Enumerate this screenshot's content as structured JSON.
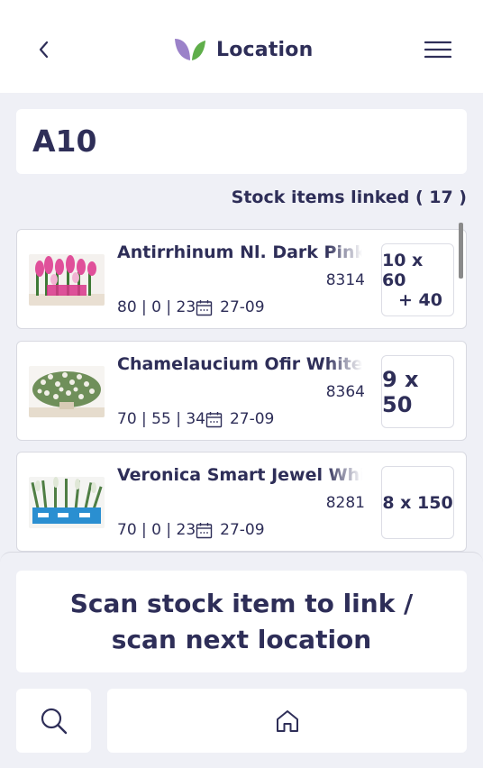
{
  "header": {
    "title": "Location",
    "back_icon": "chevron-left-icon",
    "menu_icon": "hamburger-menu-icon",
    "logo_colors": [
      "#9b82c9",
      "#5fae4a"
    ]
  },
  "location": {
    "code": "A10"
  },
  "linked_label": "Stock items linked ( 17 )",
  "items": [
    {
      "name": "Antirrhinum Nl. Dark Pink",
      "code": "8314",
      "stats": "80 | 0 | 23",
      "date": "27-09",
      "qty_line1": "10 x 60",
      "qty_line2": "+ 40"
    },
    {
      "name": "Chamelaucium Ofir White",
      "code": "8364",
      "stats": "70 | 55 | 34",
      "date": "27-09",
      "qty_line1": "9 x 50",
      "qty_line2": ""
    },
    {
      "name": "Veronica Smart Jewel White",
      "code": "8281",
      "stats": "70 | 0 | 23",
      "date": "27-09",
      "qty_line1": "8 x 150",
      "qty_line2": ""
    }
  ],
  "scan_prompt": "Scan stock item to link / scan next location",
  "colors": {
    "primary": "#2e2e58",
    "background": "#eff0f6",
    "card": "#ffffff"
  }
}
